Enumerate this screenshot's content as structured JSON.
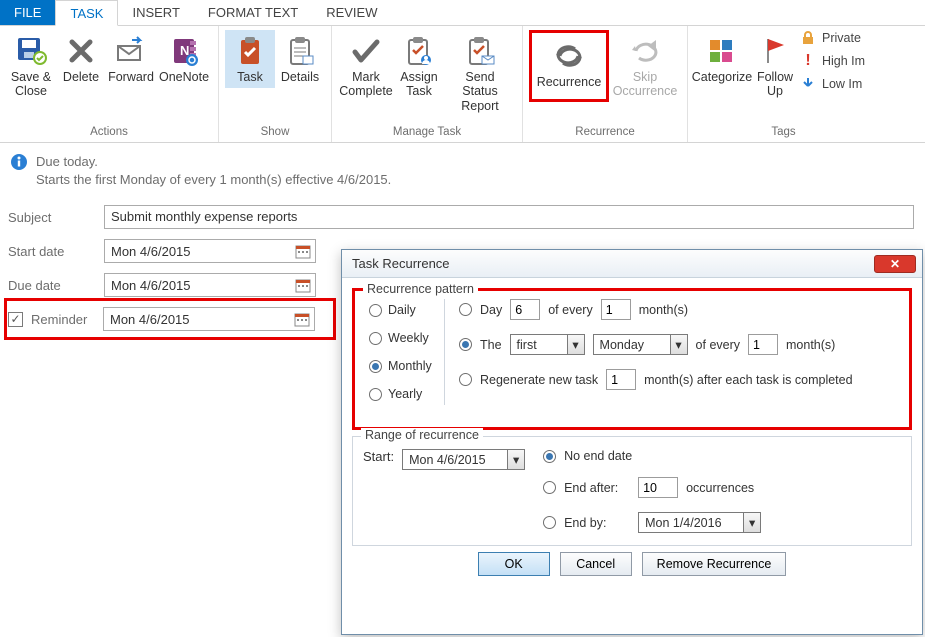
{
  "tabs": {
    "file": "FILE",
    "task": "TASK",
    "insert": "INSERT",
    "format": "FORMAT TEXT",
    "review": "REVIEW"
  },
  "ribbon": {
    "actions": {
      "label": "Actions",
      "save": "Save &\nClose",
      "delete": "Delete",
      "forward": "Forward",
      "onenote": "OneNote"
    },
    "show": {
      "label": "Show",
      "task": "Task",
      "details": "Details"
    },
    "manage": {
      "label": "Manage Task",
      "mark": "Mark\nComplete",
      "assign": "Assign\nTask",
      "send": "Send Status\nReport"
    },
    "recurrence": {
      "label": "Recurrence",
      "recurrence": "Recurrence",
      "skip": "Skip\nOccurrence"
    },
    "tags": {
      "label": "Tags",
      "categorize": "Categorize",
      "follow": "Follow\nUp",
      "private": "Private",
      "high": "High Im",
      "low": "Low Im"
    }
  },
  "info": {
    "line1": "Due today.",
    "line2": "Starts the first Monday of every 1 month(s) effective 4/6/2015."
  },
  "form": {
    "subject_label": "Subject",
    "subject": "Submit monthly expense reports",
    "start_label": "Start date",
    "start": "Mon 4/6/2015",
    "due_label": "Due date",
    "due": "Mon 4/6/2015",
    "rem_label": "Reminder",
    "rem": "Mon 4/6/2015"
  },
  "dialog": {
    "title": "Task Recurrence",
    "pattern_legend": "Recurrence pattern",
    "freq": {
      "daily": "Daily",
      "weekly": "Weekly",
      "monthly": "Monthly",
      "yearly": "Yearly"
    },
    "opt_day": "Day",
    "day_val": "6",
    "of_every": "of every",
    "ev1": "1",
    "months": "month(s)",
    "opt_the": "The",
    "ord": "first",
    "weekday": "Monday",
    "ev2": "1",
    "opt_regen": "Regenerate new task",
    "regen_val": "1",
    "regen_tail": "month(s) after each task is completed",
    "range_legend": "Range of recurrence",
    "start_label": "Start:",
    "start_val": "Mon 4/6/2015",
    "noend": "No end date",
    "endafter": "End after:",
    "endafter_val": "10",
    "occ": "occurrences",
    "endby": "End by:",
    "endby_val": "Mon 1/4/2016",
    "ok": "OK",
    "cancel": "Cancel",
    "remove": "Remove Recurrence"
  }
}
